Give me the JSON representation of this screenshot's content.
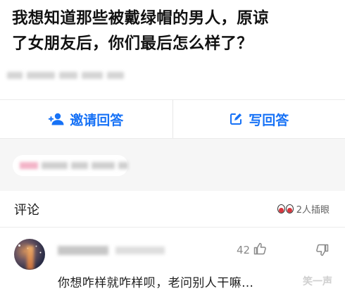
{
  "question": {
    "title_line1": "我想知道那些被戴绿帽的男人，原谅",
    "title_line2": "了女朋友后，你们最后怎么样了？"
  },
  "actions": {
    "invite_label": "邀请回答",
    "write_label": "写回答",
    "accent_color": "#1772f6"
  },
  "comments": {
    "header_title": "评论",
    "reaction_text": "2人插眼",
    "items": [
      {
        "likes": "42",
        "text": "你想咋样就咋样呗，老问别人干嘛…"
      }
    ]
  },
  "watermark": "笑一声",
  "icons": {
    "invite": "add-user-icon",
    "write": "edit-icon",
    "like": "thumbs-up-icon",
    "dislike": "thumbs-down-icon",
    "reaction": "eyes-icon"
  }
}
